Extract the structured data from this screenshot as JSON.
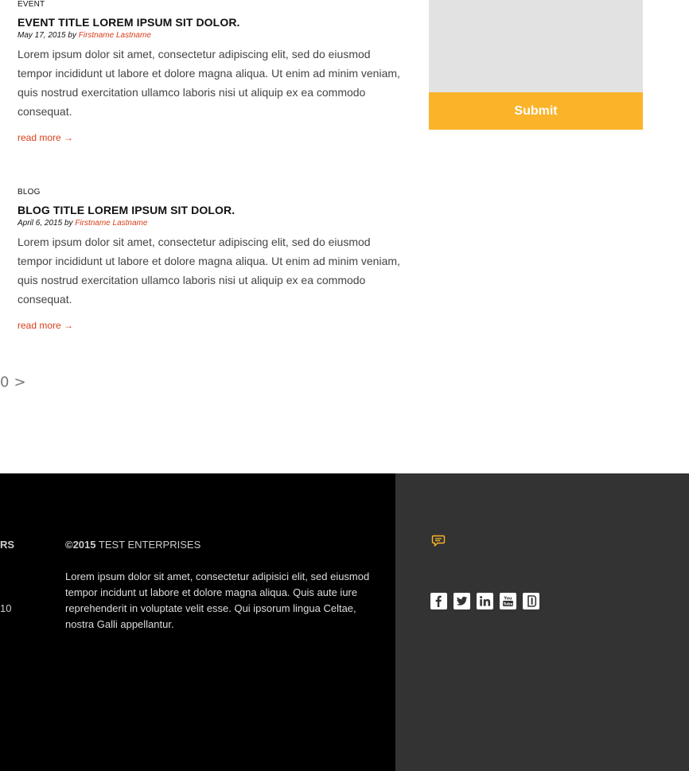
{
  "posts": [
    {
      "category": "EVENT",
      "title": "EVENT TITLE LOREM IPSUM SIT DOLOR.",
      "date": "May 17, 2015",
      "by": "by",
      "author": "Firstname Lastname",
      "body": "Lorem ipsum dolor sit amet, consectetur adipiscing elit, sed do eiusmod tempor incididunt ut labore et dolore magna aliqua. Ut enim ad minim veniam, quis nostrud exercitation ullamco laboris nisi ut aliquip ex ea commodo consequat.",
      "read_more": "read more →"
    },
    {
      "category": "BLOG",
      "title": "BLOG TITLE LOREM IPSUM SIT DOLOR.",
      "date": "April 6, 2015",
      "by": "by",
      "author": "Firstname Lastname",
      "body": "Lorem ipsum dolor sit amet, consectetur adipiscing elit, sed do eiusmod tempor incididunt ut labore et dolore magna aliqua. Ut enim ad minim veniam, quis nostrud exercitation ullamco laboris nisi ut aliquip ex ea commodo consequat.",
      "read_more": "read more →"
    }
  ],
  "sidebar": {
    "submit_label": "Submit"
  },
  "pagination": {
    "visible_number": "0",
    "next_symbol": ">"
  },
  "footer": {
    "cut_text_1": "RS",
    "cut_text_2": "10",
    "copyright_year": "©2015",
    "company": "TEST ENTERPRISES",
    "text": "Lorem ipsum dolor sit amet, consectetur adipisici elit, sed eiusmod tempor incidunt ut labore et dolore magna aliqua. Quis aute iure reprehenderit in voluptate velit esse. Qui ipsorum lingua Celtae, nostra Galli appellantur.",
    "social_icons": [
      "facebook-icon",
      "twitter-icon",
      "linkedin-icon",
      "youtube-icon",
      "blogger-icon"
    ]
  },
  "colors": {
    "accent": "#fbb32a",
    "link": "#d8401c",
    "footer_left_bg": "#000000",
    "footer_right_bg": "#333333",
    "input_bg": "#e2e2e2"
  }
}
